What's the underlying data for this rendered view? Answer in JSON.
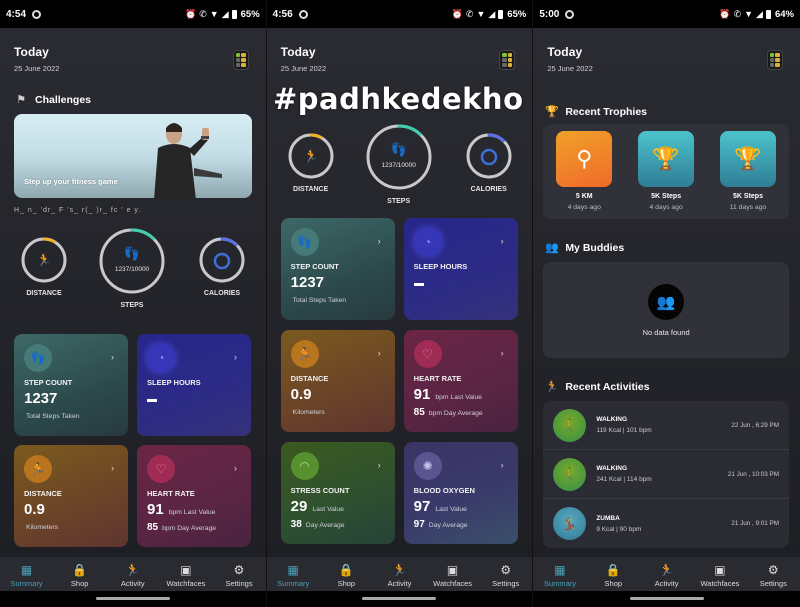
{
  "overlay_text": "#padhkedekho",
  "screens": [
    {
      "status": {
        "time": "4:54",
        "battery": "65%"
      },
      "header": {
        "title": "Today",
        "date": "25 June 2022"
      },
      "challenges": {
        "title": "Challenges",
        "banner_caption": "Step up your fitness game",
        "garbled_text": "H_ n_ 'dr_ F 's_ r(_ )r_ fc ' e y."
      },
      "rings": {
        "distance": {
          "label": "DISTANCE",
          "progress": 0.08
        },
        "steps": {
          "label": "STEPS",
          "value": "1237/10000",
          "progress": 0.12
        },
        "calories": {
          "label": "CALORIES",
          "progress": 0.12
        }
      },
      "cards": [
        {
          "name": "STEP COUNT",
          "value": "1237",
          "sub": "Total Steps Taken"
        },
        {
          "name": "SLEEP HOURS",
          "value": "–"
        },
        {
          "name": "DISTANCE",
          "value": "0.9",
          "sub": "Kilometers"
        },
        {
          "name": "HEART RATE",
          "value": "91",
          "value_unit": "bpm Last Value",
          "avg": "85",
          "avg_unit": "bpm Day Average"
        }
      ]
    },
    {
      "status": {
        "time": "4:56",
        "battery": "65%"
      },
      "header": {
        "title": "Today",
        "date": "25 June 2022"
      },
      "rings": {
        "distance": {
          "label": "DISTANCE",
          "progress": 0.08
        },
        "steps": {
          "label": "STEPS",
          "value": "1237/10000",
          "progress": 0.12
        },
        "calories": {
          "label": "CALORIES",
          "progress": 0.12
        }
      },
      "cards": [
        {
          "name": "STEP COUNT",
          "value": "1237",
          "sub": "Total Steps Taken"
        },
        {
          "name": "SLEEP HOURS",
          "value": "–"
        },
        {
          "name": "DISTANCE",
          "value": "0.9",
          "sub": "Kilometers"
        },
        {
          "name": "HEART RATE",
          "value": "91",
          "value_unit": "bpm Last Value",
          "avg": "85",
          "avg_unit": "bpm Day Average"
        },
        {
          "name": "STRESS COUNT",
          "value": "29",
          "value_unit": "Last Value",
          "avg": "38",
          "avg_unit": "Day Average"
        },
        {
          "name": "BLOOD OXYGEN",
          "value": "97",
          "value_unit": "Last Value",
          "avg": "97",
          "avg_unit": "Day Average"
        }
      ]
    },
    {
      "status": {
        "time": "5:00",
        "battery": "64%"
      },
      "header": {
        "title": "Today",
        "date": "25 June 2022"
      },
      "trophies": {
        "title": "Recent Trophies",
        "items": [
          {
            "name": "5 KM",
            "when": "4 days ago",
            "color": "#f08a2a"
          },
          {
            "name": "5K Steps",
            "when": "4 days ago",
            "color": "#3aa3b5"
          },
          {
            "name": "5K Steps",
            "when": "11 days ago",
            "color": "#3aa3b5"
          }
        ]
      },
      "buddies": {
        "title": "My Buddies",
        "empty_text": "No data found"
      },
      "activities": {
        "title": "Recent Activities",
        "items": [
          {
            "name": "WALKING",
            "meta": "119 Kcal | 101 bpm",
            "time": "22 Jun , 6:29 PM"
          },
          {
            "name": "WALKING",
            "meta": "241 Kcal | 114 bpm",
            "time": "21 Jun , 10:03 PM"
          },
          {
            "name": "ZUMBA",
            "meta": "9 Kcal | 90 bpm",
            "time": "21 Jun , 9:01 PM"
          }
        ]
      }
    }
  ],
  "nav": {
    "items": [
      {
        "label": "Summary",
        "icon": "grid-icon"
      },
      {
        "label": "Shop",
        "icon": "bag-icon"
      },
      {
        "label": "Activity",
        "icon": "runner-icon"
      },
      {
        "label": "Watchfaces",
        "icon": "watchface-icon"
      },
      {
        "label": "Settings",
        "icon": "gear-icon"
      }
    ],
    "active": "Summary"
  },
  "colors": {
    "accent": "#4aa1b8",
    "distance_ring": "#f0b429",
    "steps_ring": "#3ecfb0",
    "calories_ring": "#5a6fe6",
    "ring_track": "#c9c9cc"
  }
}
